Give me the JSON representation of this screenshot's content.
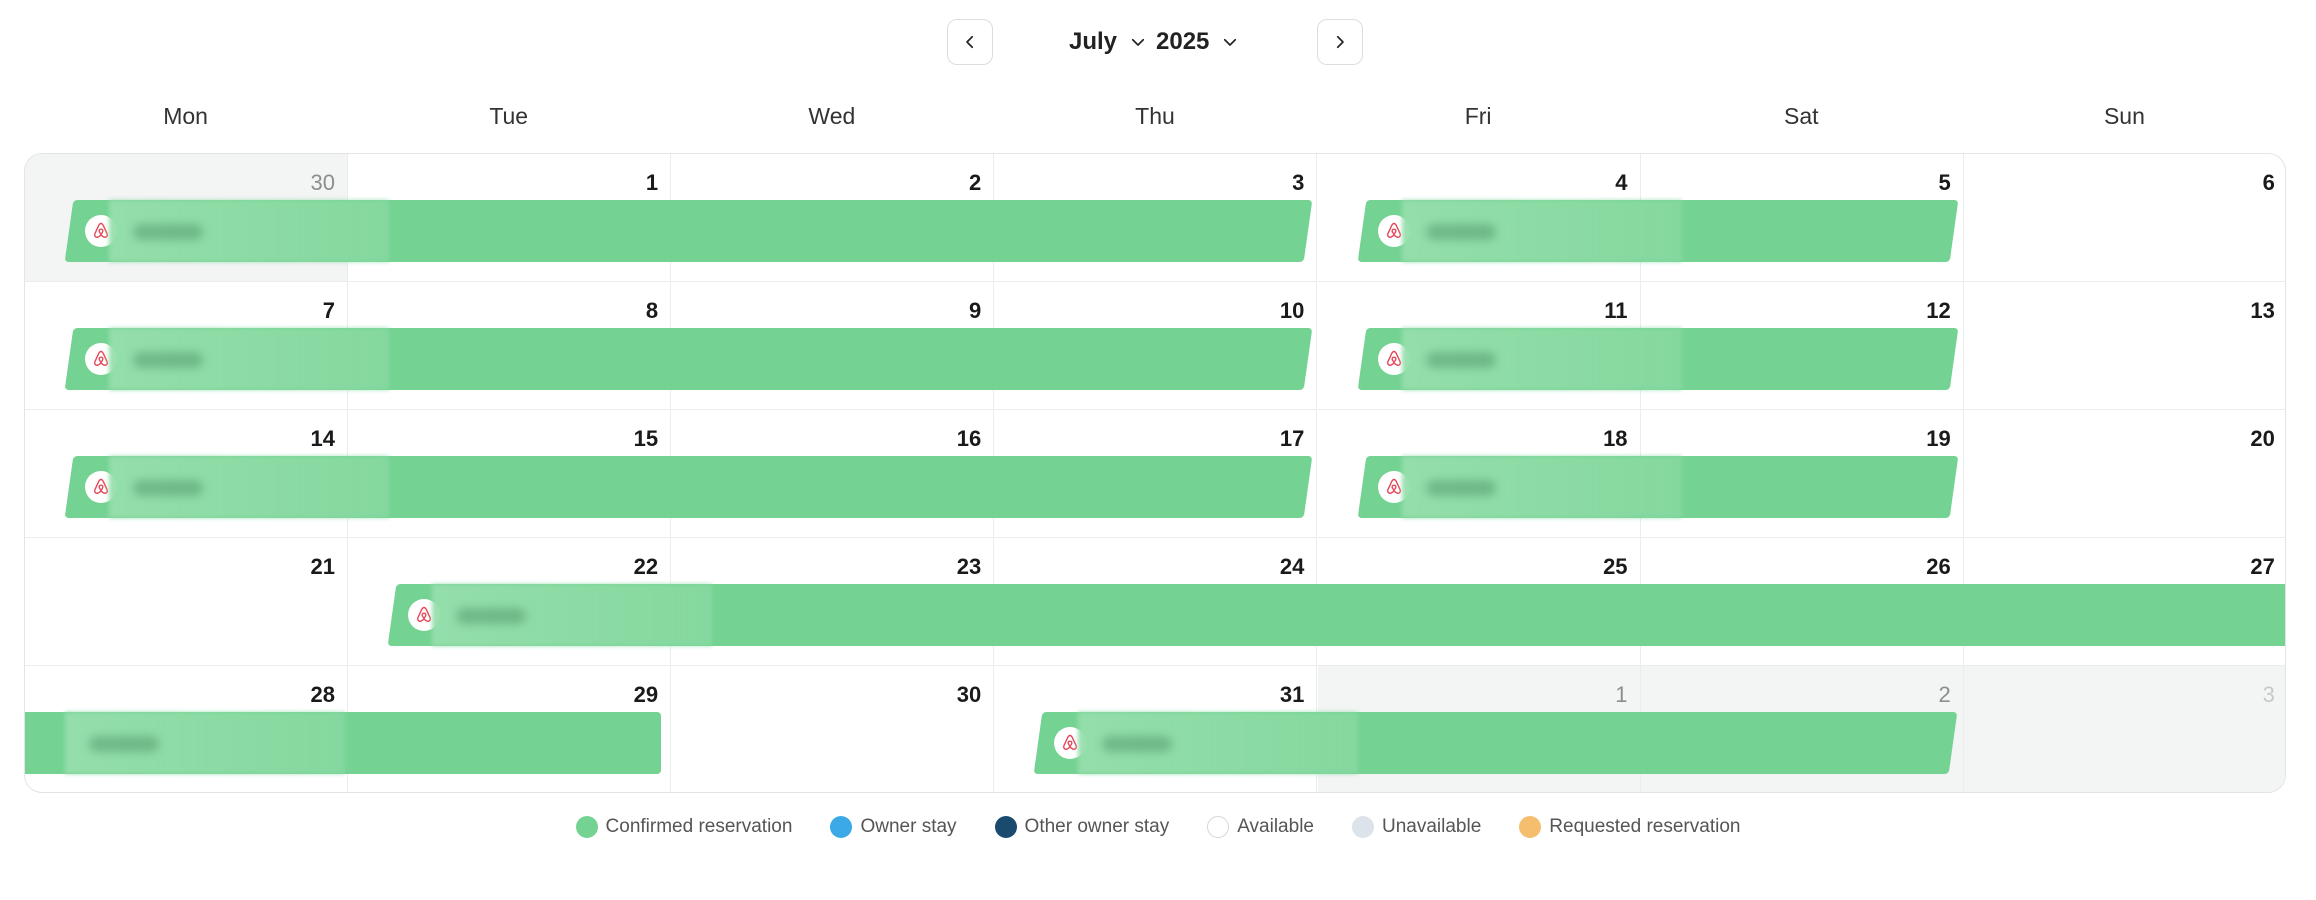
{
  "header": {
    "month": "July",
    "year": "2025"
  },
  "weekdays": [
    "Mon",
    "Tue",
    "Wed",
    "Thu",
    "Fri",
    "Sat",
    "Sun"
  ],
  "weeks": [
    [
      {
        "day": "30",
        "state": "muted"
      },
      {
        "day": "1"
      },
      {
        "day": "2"
      },
      {
        "day": "3"
      },
      {
        "day": "4"
      },
      {
        "day": "5"
      },
      {
        "day": "6"
      }
    ],
    [
      {
        "day": "7"
      },
      {
        "day": "8"
      },
      {
        "day": "9"
      },
      {
        "day": "10"
      },
      {
        "day": "11"
      },
      {
        "day": "12"
      },
      {
        "day": "13"
      }
    ],
    [
      {
        "day": "14"
      },
      {
        "day": "15"
      },
      {
        "day": "16"
      },
      {
        "day": "17"
      },
      {
        "day": "18"
      },
      {
        "day": "19"
      },
      {
        "day": "20"
      }
    ],
    [
      {
        "day": "21"
      },
      {
        "day": "22"
      },
      {
        "day": "23"
      },
      {
        "day": "24"
      },
      {
        "day": "25"
      },
      {
        "day": "26"
      },
      {
        "day": "27"
      }
    ],
    [
      {
        "day": "28"
      },
      {
        "day": "29"
      },
      {
        "day": "30"
      },
      {
        "day": "31"
      },
      {
        "day": "1",
        "state": "muted"
      },
      {
        "day": "2",
        "state": "muted"
      },
      {
        "day": "3",
        "state": "faded"
      }
    ]
  ],
  "reservations": [
    {
      "week": 0,
      "start": 0,
      "end": 4,
      "status": "confirmed",
      "source": "airbnb-icon"
    },
    {
      "week": 0,
      "start": 4,
      "end": 6,
      "status": "confirmed",
      "source": "airbnb-icon"
    },
    {
      "week": 1,
      "start": 0,
      "end": 4,
      "status": "confirmed",
      "source": "airbnb-icon"
    },
    {
      "week": 1,
      "start": 4,
      "end": 6,
      "status": "confirmed",
      "source": "airbnb-icon"
    },
    {
      "week": 2,
      "start": 0,
      "end": 4,
      "status": "confirmed",
      "source": "airbnb-icon"
    },
    {
      "week": 2,
      "start": 4,
      "end": 6,
      "status": "confirmed",
      "source": "airbnb-icon"
    },
    {
      "week": 3,
      "start": 1,
      "end": 7,
      "status": "confirmed",
      "source": "airbnb-icon",
      "continues": true
    },
    {
      "week": 4,
      "start": 0,
      "end": 2,
      "status": "confirmed",
      "continued": true
    },
    {
      "week": 4,
      "start": 3,
      "end": 6,
      "status": "confirmed",
      "source": "airbnb-icon"
    }
  ],
  "legend": [
    {
      "label": "Confirmed reservation",
      "color": "#74d393",
      "icon": "legend-dot"
    },
    {
      "label": "Owner stay",
      "color": "#3aa9e6",
      "icon": "legend-dot"
    },
    {
      "label": "Other owner stay",
      "color": "#1a4a6e",
      "icon": "legend-dot"
    },
    {
      "label": "Available",
      "color": "#ffffff",
      "icon": "legend-dot"
    },
    {
      "label": "Unavailable",
      "color": "#dde3ea",
      "icon": "legend-dot"
    },
    {
      "label": "Requested reservation",
      "color": "#f5be6e",
      "icon": "legend-dot"
    }
  ],
  "colors": {
    "confirmed": "#74d393",
    "accent": "#222222",
    "muted_cell": "#f3f4f4"
  }
}
